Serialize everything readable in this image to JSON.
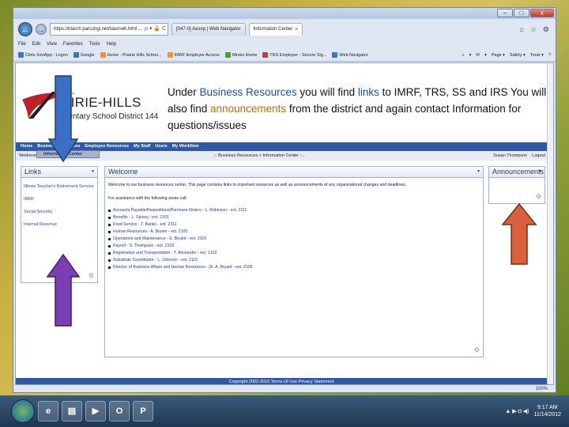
{
  "browser": {
    "window_controls": {
      "minimize": "–",
      "maximize": "□",
      "close": "x"
    },
    "nav": {
      "back_icon": "←",
      "forward_icon": "→",
      "refresh_icon": "▾"
    },
    "address": "https://triarch.parcshgi.net/tiasinwh.html ...",
    "address_icons": "ρ ▾ 🔒 C ×",
    "tabs": [
      {
        "label": "[047-0] Aesop | Web Navigator"
      },
      {
        "label": "Information Center",
        "close": "×"
      }
    ],
    "right_icons": [
      "⌂",
      "☆",
      "⚙"
    ],
    "menu": [
      "File",
      "Edit",
      "View",
      "Favorites",
      "Tools",
      "Help"
    ],
    "favorites": [
      {
        "label": "Citrix XenApp - Logon",
        "color": "#3d74c4"
      },
      {
        "label": "Google",
        "color": "#3d74c4"
      },
      {
        "label": "Home - Prairie Hills Schoo...",
        "color": "#e59a2b"
      },
      {
        "label": "IMRF Employer Access",
        "color": "#e59a2b"
      },
      {
        "label": "Illinois Home",
        "color": "#4d9a3c"
      },
      {
        "label": "TRS Employer - Secure Sig...",
        "color": "#c23a3a"
      },
      {
        "label": "Web Navigator",
        "color": "#3d74c4"
      }
    ],
    "command_bar": [
      "»",
      "▾",
      "✉",
      "▾",
      "Page ▾",
      "Safety ▾",
      "Tools ▾",
      "?"
    ],
    "zoom": "100%"
  },
  "logo": {
    "title": "AIRIE-HILLS",
    "subtitle": "mentary School District 144"
  },
  "note": {
    "p1": "Under ",
    "p2": "Business Resources",
    "p3": " you will find ",
    "p4": "links",
    "p5": " to IMRF, TRS, SS and IRS You will also find ",
    "p6": "announcements",
    "p7": " from the district and again contact Information for questions/issues"
  },
  "portal": {
    "nav": [
      "Home",
      "Business Resources",
      "Employee Resources",
      "My Staff",
      "Users",
      "My Workflow"
    ],
    "submenu": "Information Center",
    "date": "Wednesday, November 14, 2012",
    "breadcrumb": ".:: Business Resources > Information Center ::..",
    "user": "Susan Thompson",
    "logout": "Logout",
    "links_title": "Links",
    "links": [
      "Illinois Teacher's Retirement Service",
      "IMRF",
      "Social Security",
      "Internal Revenue"
    ],
    "welcome_title": "Welcome",
    "welcome_intro": "Welcome to our business resources center. This page contains links to important resources as well as announcements of any organizational changes and deadlines.",
    "welcome_assist": "For assistance with the following areas call:",
    "contacts": [
      "Accounts Payable/Requisitions/Purchase Orders - L. Robinson - ext. 2111",
      "Benefits - L. Spivey - ext. 2101",
      "Food Service - T. Banks - ext. 2311",
      "Human Resources - A. Brown - ext. 2105",
      "Operations and Maintenance - E. Bryant - ext. 2116",
      "Payroll - S. Thompson - ext. 2103",
      "Registration and Transportation - T. Alexander - ext. 2102",
      "Substitute Coordinator - L. Johnson - ext. 2115",
      "Director of Business Affairs and Human Resources - Dr. A. Bryant - ext. 2105"
    ],
    "announcements_title": "Announcements",
    "footer": "Copyright 2002-2010   Terms Of Use   Privacy Statement"
  },
  "taskbar": {
    "apps": [
      "e",
      "▤",
      "▶",
      "O",
      "P"
    ],
    "tray": "▲ ▶ ◘ ◀)",
    "time": "9:17 AM",
    "date": "11/14/2012"
  },
  "colors": {
    "portal_blue": "#2f58a7",
    "arrow_blue": "#3b6fc4",
    "arrow_purple": "#7b3fb3",
    "arrow_orange": "#d9603c",
    "logo_red": "#c0202a"
  }
}
